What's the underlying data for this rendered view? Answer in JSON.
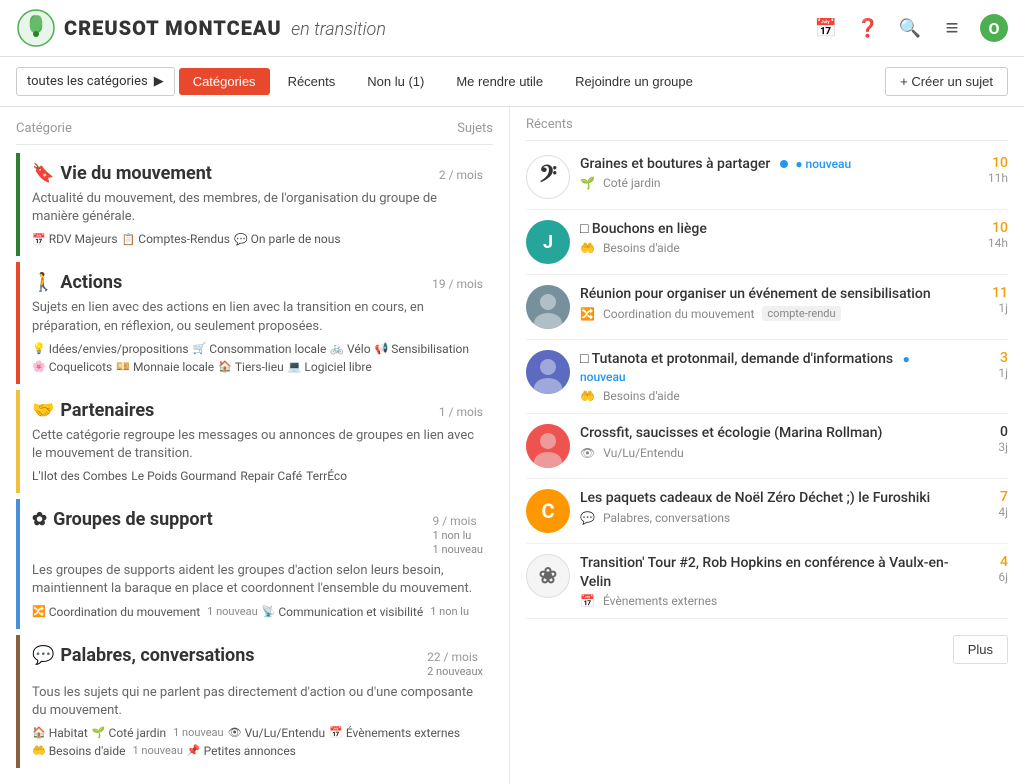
{
  "header": {
    "logo_text": "CREUSOT MONTCEAU",
    "logo_subtext": "en transition",
    "icons": {
      "calendar": "📅",
      "help": "❓",
      "search": "🔍",
      "menu": "≡",
      "avatar": "O"
    }
  },
  "navbar": {
    "dropdown_label": "toutes les catégories",
    "tabs": [
      {
        "id": "categories",
        "label": "Catégories",
        "active": true
      },
      {
        "id": "recents",
        "label": "Récents",
        "active": false
      },
      {
        "id": "nonlu",
        "label": "Non lu (1)",
        "active": false
      },
      {
        "id": "merendre",
        "label": "Me rendre utile",
        "active": false
      },
      {
        "id": "rejoindre",
        "label": "Rejoindre un groupe",
        "active": false
      }
    ],
    "create_btn": "+ Créer un sujet"
  },
  "col_headers": {
    "category": "Catégorie",
    "subjects": "Sujets",
    "recents": "Récents"
  },
  "categories": [
    {
      "id": "vie",
      "color": "dark-green",
      "icon": "🔖",
      "title": "Vie du mouvement",
      "count": "2 / mois",
      "description": "Actualité du mouvement, des membres, de l'organisation du groupe de manière générale.",
      "tags": [
        {
          "icon": "📅",
          "label": "RDV Majeurs"
        },
        {
          "icon": "📋",
          "label": "Comptes-Rendus"
        },
        {
          "icon": "💬",
          "label": "On parle de nous"
        }
      ]
    },
    {
      "id": "actions",
      "color": "red",
      "icon": "🚶",
      "title": "Actions",
      "count": "19 / mois",
      "description": "Sujets en lien avec des actions en lien avec la transition en cours, en préparation, en réflexion, ou seulement proposées.",
      "tags": [
        {
          "icon": "💡",
          "label": "Idées/envies/propositions"
        },
        {
          "icon": "🛒",
          "label": "Consommation locale"
        },
        {
          "icon": "🚲",
          "label": "Vélo"
        },
        {
          "icon": "📢",
          "label": "Sensibilisation"
        },
        {
          "icon": "🌸",
          "label": "Coquelicots"
        },
        {
          "icon": "💴",
          "label": "Monnaie locale"
        },
        {
          "icon": "🏠",
          "label": "Tiers-lieu"
        },
        {
          "icon": "💻",
          "label": "Logiciel libre"
        }
      ]
    },
    {
      "id": "partenaires",
      "color": "yellow",
      "icon": "🤝",
      "title": "Partenaires",
      "count": "1 / mois",
      "description": "Cette catégorie regroupe les messages ou annonces de groupes en lien avec le mouvement de transition.",
      "tags": [
        {
          "icon": "",
          "label": "L'Ilot des Combes"
        },
        {
          "icon": "",
          "label": "Le Poids Gourmand"
        },
        {
          "icon": "",
          "label": "Repair Café"
        },
        {
          "icon": "",
          "label": "TerrÉco"
        }
      ]
    },
    {
      "id": "groupes",
      "color": "blue",
      "icon": "✿",
      "title": "Groupes de support",
      "count": "9 / mois",
      "extra": "1 non lu\n1 nouveau",
      "description": "Les groupes de supports aident les groupes d'action selon leurs besoin, maintiennent la baraque en place et coordonnent l'ensemble du mouvement.",
      "tags": [
        {
          "icon": "🔀",
          "label": "Coordination du mouvement",
          "badge": "1 nouveau"
        },
        {
          "icon": "📡",
          "label": "Communication et visibilité",
          "badge": "1 non lu"
        }
      ]
    },
    {
      "id": "palabres",
      "color": "brown",
      "icon": "💬",
      "title": "Palabres, conversations",
      "count": "22 / mois",
      "extra": "2 nouveaux",
      "description": "Tous les sujets qui ne parlent pas directement d'action ou d'une composante du mouvement.",
      "tags": [
        {
          "icon": "🏠",
          "label": "Habitat"
        },
        {
          "icon": "🌱",
          "label": "Coté jardin",
          "badge": "1 nouveau"
        },
        {
          "icon": "👁",
          "label": "Vu/Lu/Entendu"
        },
        {
          "icon": "📅",
          "label": "Évènements externes"
        },
        {
          "icon": "🤲",
          "label": "Besoins d'aide",
          "badge": "1 nouveau"
        },
        {
          "icon": "📌",
          "label": "Petites annonces"
        }
      ]
    }
  ],
  "recents": [
    {
      "id": "r1",
      "avatar_type": "music",
      "avatar_text": "𝄢",
      "title": "Graines et boutures à partager",
      "is_new": true,
      "sub_icon": "🌱",
      "sub_label": "Coté jardin",
      "count": "10",
      "time": "11h"
    },
    {
      "id": "r2",
      "avatar_type": "teal",
      "avatar_text": "J",
      "title": "□ Bouchons en liège",
      "is_new": false,
      "sub_icon": "🤲",
      "sub_label": "Besoins d'aide",
      "count": "10",
      "time": "14h"
    },
    {
      "id": "r3",
      "avatar_type": "photo",
      "avatar_text": "",
      "title": "Réunion pour organiser un événement de sensibilisation",
      "is_new": false,
      "sub_icon": "🔀",
      "sub_label": "Coordination du mouvement",
      "tag": "compte-rendu",
      "count": "11",
      "time": "1j"
    },
    {
      "id": "r4",
      "avatar_type": "photo2",
      "avatar_text": "",
      "title": "□ Tutanota et protonmail, demande d'informations",
      "is_new": true,
      "sub_icon": "🤲",
      "sub_label": "Besoins d'aide",
      "count": "3",
      "time": "1j"
    },
    {
      "id": "r5",
      "avatar_type": "photo3",
      "avatar_text": "",
      "title": "Crossfit, saucisses et écologie (Marina Rollman)",
      "is_new": false,
      "sub_icon": "👁",
      "sub_label": "Vu/Lu/Entendu",
      "count": "0",
      "time": "3j"
    },
    {
      "id": "r6",
      "avatar_type": "c",
      "avatar_text": "C",
      "title": "Les paquets cadeaux de Noël Zéro Déchet ;) le Furoshiki",
      "is_new": false,
      "sub_icon": "💬",
      "sub_label": "Palabres, conversations",
      "count": "7",
      "time": "4j"
    },
    {
      "id": "r7",
      "avatar_type": "flower",
      "avatar_text": "❀",
      "title": "Transition' Tour #2, Rob Hopkins en conférence à Vaulx-en-Velin",
      "is_new": false,
      "sub_icon": "📅",
      "sub_label": "Évènements externes",
      "count": "4",
      "time": "6j"
    }
  ],
  "more_btn": "Plus"
}
